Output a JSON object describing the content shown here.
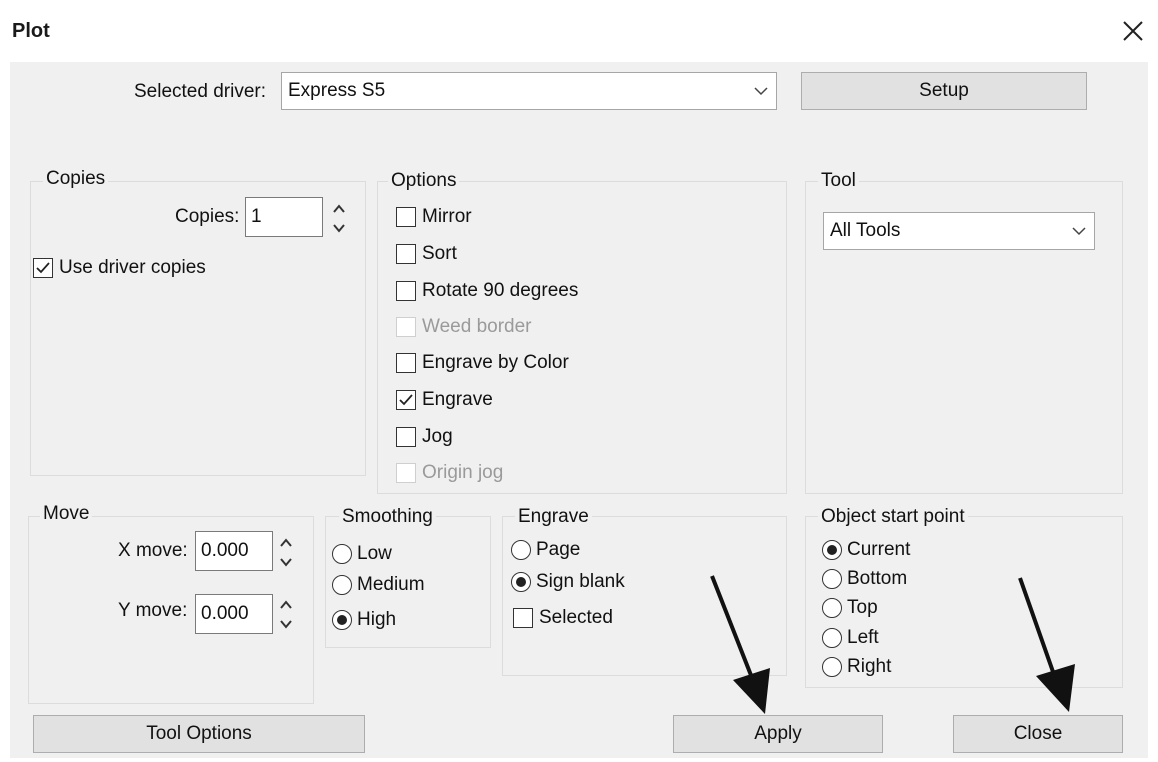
{
  "window": {
    "title": "Plot"
  },
  "driver": {
    "label": "Selected driver:",
    "value": "Express S5",
    "setup_label": "Setup"
  },
  "copies": {
    "legend": "Copies",
    "copies_label": "Copies:",
    "copies_value": "1",
    "use_driver_copies_label": "Use driver copies",
    "use_driver_copies_checked": true
  },
  "options": {
    "legend": "Options",
    "items": [
      {
        "label": "Mirror",
        "checked": false,
        "enabled": true
      },
      {
        "label": "Sort",
        "checked": false,
        "enabled": true
      },
      {
        "label": "Rotate 90 degrees",
        "checked": false,
        "enabled": true
      },
      {
        "label": "Weed border",
        "checked": false,
        "enabled": false
      },
      {
        "label": "Engrave by Color",
        "checked": false,
        "enabled": true
      },
      {
        "label": "Engrave",
        "checked": true,
        "enabled": true
      },
      {
        "label": "Jog",
        "checked": false,
        "enabled": true
      },
      {
        "label": "Origin jog",
        "checked": false,
        "enabled": false
      }
    ]
  },
  "tool": {
    "legend": "Tool",
    "value": "All Tools"
  },
  "move": {
    "legend": "Move",
    "x_label": "X move:",
    "x_value": "0.000",
    "y_label": "Y move:",
    "y_value": "0.000"
  },
  "smoothing": {
    "legend": "Smoothing",
    "options": [
      {
        "label": "Low",
        "selected": false
      },
      {
        "label": "Medium",
        "selected": false
      },
      {
        "label": "High",
        "selected": true
      }
    ]
  },
  "engrave": {
    "legend": "Engrave",
    "options": [
      {
        "label": "Page",
        "selected": false
      },
      {
        "label": "Sign blank",
        "selected": true
      }
    ],
    "selected_label": "Selected",
    "selected_checked": false
  },
  "object_start": {
    "legend": "Object start point",
    "options": [
      {
        "label": "Current",
        "selected": true
      },
      {
        "label": "Bottom",
        "selected": false
      },
      {
        "label": "Top",
        "selected": false
      },
      {
        "label": "Left",
        "selected": false
      },
      {
        "label": "Right",
        "selected": false
      }
    ]
  },
  "buttons": {
    "tool_options": "Tool Options",
    "apply": "Apply",
    "close": "Close"
  },
  "icons": {
    "close": "close-icon",
    "chevron": "chevron-down-icon",
    "spin": "spin-up-down-icon",
    "check": "checkmark-icon",
    "arrow": "arrow-annotation-icon"
  }
}
